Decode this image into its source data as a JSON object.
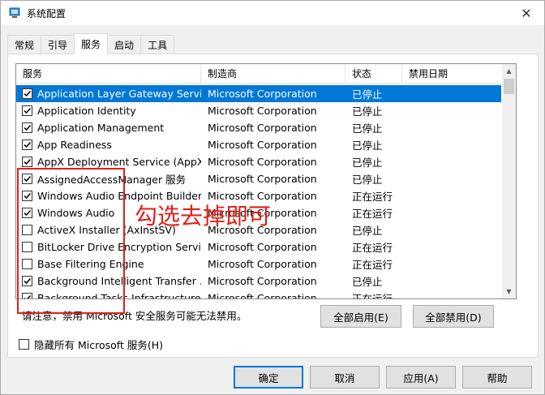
{
  "window": {
    "title": "系统配置",
    "close_glyph": "✕"
  },
  "tabs": [
    {
      "label": "常规"
    },
    {
      "label": "引导"
    },
    {
      "label": "服务"
    },
    {
      "label": "启动"
    },
    {
      "label": "工具"
    }
  ],
  "active_tab": "服务",
  "columns": {
    "service": "服务",
    "manufacturer": "制造商",
    "status": "状态",
    "disabled_date": "禁用日期"
  },
  "rows": [
    {
      "name": "Application Layer Gateway Service",
      "manufacturer": "Microsoft Corporation",
      "status": "已停止",
      "checked": true,
      "selected": true
    },
    {
      "name": "Application Identity",
      "manufacturer": "Microsoft Corporation",
      "status": "已停止",
      "checked": true
    },
    {
      "name": "Application Management",
      "manufacturer": "Microsoft Corporation",
      "status": "已停止",
      "checked": true
    },
    {
      "name": "App Readiness",
      "manufacturer": "Microsoft Corporation",
      "status": "已停止",
      "checked": true
    },
    {
      "name": "AppX Deployment Service (AppX...",
      "manufacturer": "Microsoft Corporation",
      "status": "已停止",
      "checked": true
    },
    {
      "name": "AssignedAccessManager 服务",
      "manufacturer": "Microsoft Corporation",
      "status": "已停止",
      "checked": true
    },
    {
      "name": "Windows Audio Endpoint Builder",
      "manufacturer": "Microsoft Corporation",
      "status": "正在运行",
      "checked": true
    },
    {
      "name": "Windows Audio",
      "manufacturer": "Microsoft Corporation",
      "status": "正在运行",
      "checked": true
    },
    {
      "name": "ActiveX Installer (AxInstSV)",
      "manufacturer": "Microsoft Corporation",
      "status": "已停止",
      "checked": false
    },
    {
      "name": "BitLocker Drive Encryption Service",
      "manufacturer": "Microsoft Corporation",
      "status": "正在运行",
      "checked": false
    },
    {
      "name": "Base Filtering Engine",
      "manufacturer": "Microsoft Corporation",
      "status": "正在运行",
      "checked": false
    },
    {
      "name": "Background Intelligent Transfer ...",
      "manufacturer": "Microsoft Corporation",
      "status": "已停止",
      "checked": true
    },
    {
      "name": "Background Tasks Infrastructure ...",
      "manufacturer": "Microsoft Corporation",
      "status": "正在运行",
      "checked": true
    }
  ],
  "note": "请注意，禁用 Microsoft 安全服务可能无法禁用。",
  "buttons": {
    "enable_all": "全部启用(E)",
    "disable_all": "全部禁用(D)",
    "ok": "确定",
    "cancel": "取消",
    "apply": "应用(A)",
    "help": "帮助"
  },
  "hide_ms": {
    "label": "隐藏所有 Microsoft 服务(H)",
    "checked": false
  },
  "annotation": "勾选去掉即可",
  "colors": {
    "selection": "#0078d7",
    "annotation": "#e0201b"
  }
}
